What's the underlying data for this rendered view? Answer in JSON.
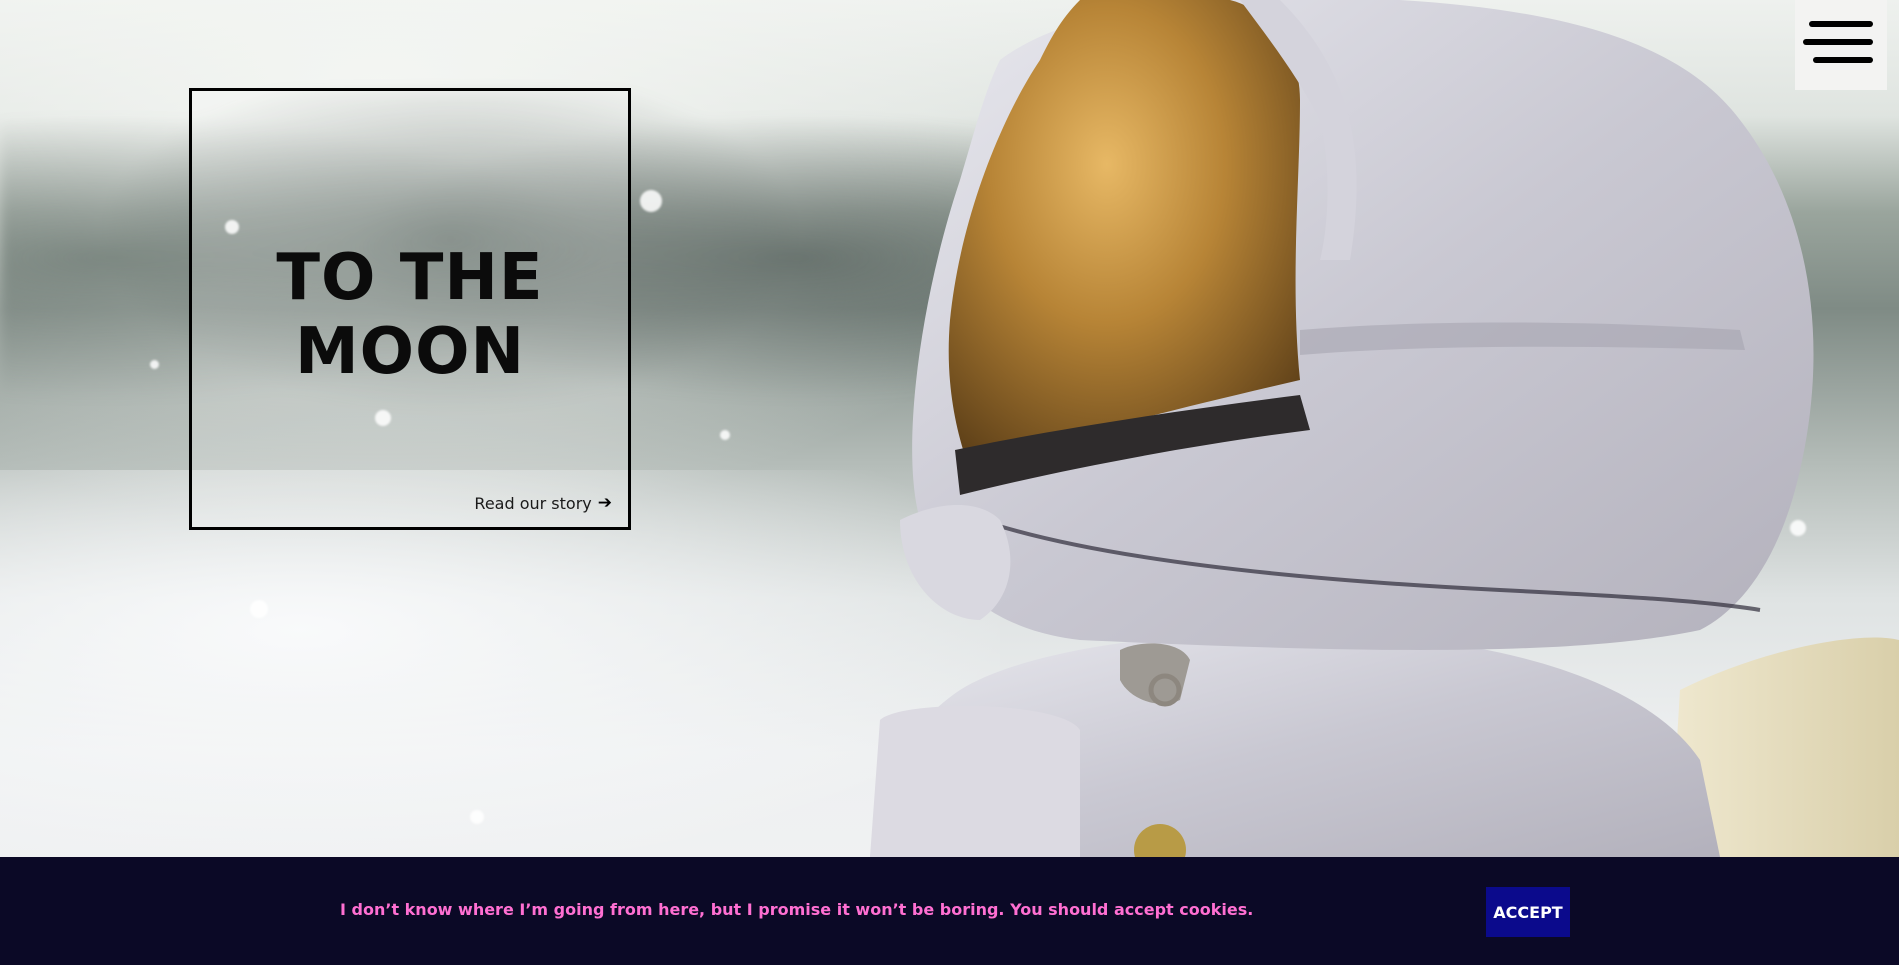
{
  "hero": {
    "title_line1": "TO THE",
    "title_line2": "MOON",
    "link_label": "Read our story",
    "link_arrow": "➔"
  },
  "menu": {
    "icon": "hamburger-menu-icon"
  },
  "cookie_banner": {
    "message": "I don’t know where I’m going from here, but I promise it won’t be boring. You should accept cookies.",
    "accept_label": "ACCEPT",
    "text_color": "#ff6fd2",
    "background_color": "#0b0926",
    "button_color": "#0b0a8c"
  }
}
